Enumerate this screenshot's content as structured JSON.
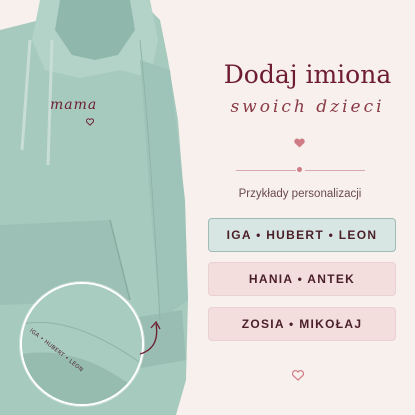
{
  "hoodie": {
    "chest_text": "mama",
    "sleeve_text": "IGA • HUBERT • LEON"
  },
  "headline": {
    "title": "Dodaj imiona",
    "subtitle": "swoich dzieci"
  },
  "examples": {
    "label": "Przykłady personalizacji",
    "items": [
      "IGA • HUBERT • LEON",
      "HANIA • ANTEK",
      "ZOSIA • MIKOŁAJ"
    ]
  },
  "colors": {
    "background": "#f7f0ec",
    "accent": "#6e1d30",
    "hoodie": "#a7cabf",
    "card_mint": "#d8e6e3",
    "card_pink": "#f3dddd"
  },
  "icons": [
    "heart-icon",
    "divider-heart-icon",
    "bottom-heart-icon",
    "curved-arrow-icon"
  ]
}
